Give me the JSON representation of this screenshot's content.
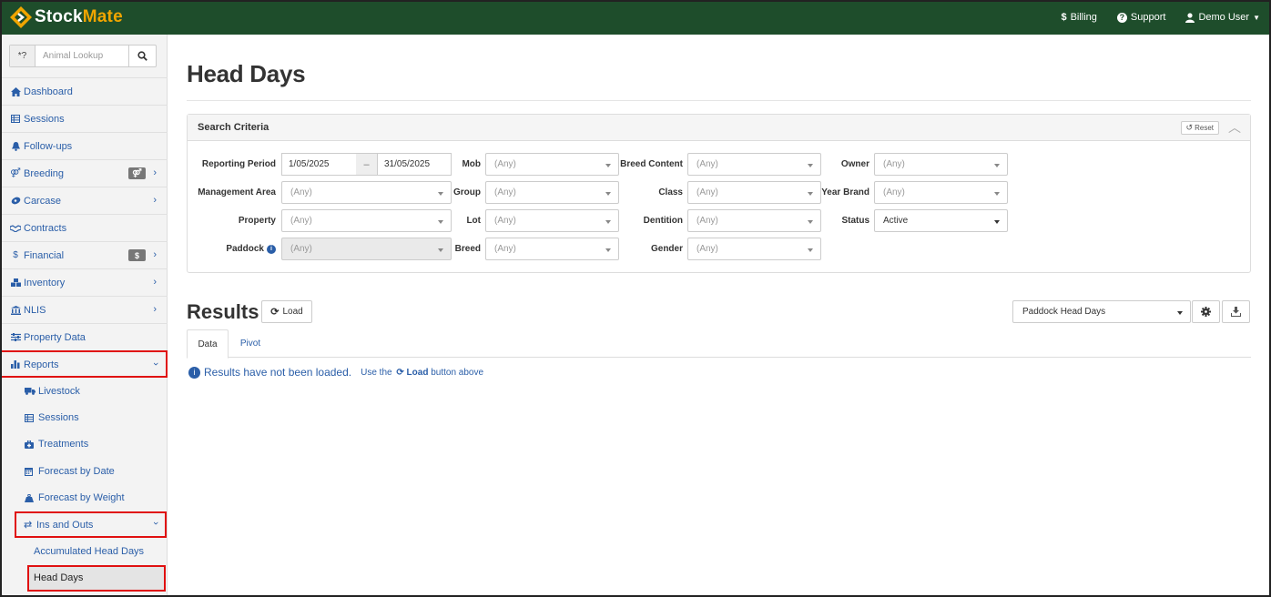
{
  "app": {
    "brand_part1": "Stock",
    "brand_part2": "Mate",
    "accent": "#1e4d2b",
    "link_color": "#2a5ea8"
  },
  "topnav": {
    "billing": "Billing",
    "support": "Support",
    "user": "Demo User"
  },
  "sidebar": {
    "lookup_prefix": "*?",
    "lookup_placeholder": "Animal Lookup",
    "items": [
      {
        "label": "Dashboard",
        "icon": "home-icon"
      },
      {
        "label": "Sessions",
        "icon": "table-icon"
      },
      {
        "label": "Follow-ups",
        "icon": "bell-icon"
      },
      {
        "label": "Breeding",
        "icon": "gender-icon"
      },
      {
        "label": "Carcase",
        "icon": "carcase-icon"
      },
      {
        "label": "Contracts",
        "icon": "handshake-icon"
      },
      {
        "label": "Financial",
        "icon": "dollar-icon",
        "tag": "$"
      },
      {
        "label": "Inventory",
        "icon": "boxes-icon"
      },
      {
        "label": "NLIS",
        "icon": "bank-icon"
      },
      {
        "label": "Property Data",
        "icon": "sliders-icon"
      },
      {
        "label": "Reports",
        "icon": "bar-chart-icon"
      }
    ],
    "reports_sub": [
      {
        "label": "Livestock",
        "icon": "truck-icon"
      },
      {
        "label": "Sessions",
        "icon": "table-icon"
      },
      {
        "label": "Treatments",
        "icon": "medkit-icon"
      },
      {
        "label": "Forecast by Date",
        "icon": "calendar-icon"
      },
      {
        "label": "Forecast by Weight",
        "icon": "weight-icon"
      },
      {
        "label": "Ins and Outs",
        "icon": "exchange-icon"
      }
    ],
    "insouts_sub": [
      {
        "label": "Accumulated Head Days"
      },
      {
        "label": "Head Days"
      }
    ]
  },
  "page": {
    "title": "Head Days"
  },
  "criteria": {
    "title": "Search Criteria",
    "reset": "Reset",
    "reporting_period_label": "Reporting Period",
    "date_from": "1/05/2025",
    "date_sep": "–",
    "date_to": "31/05/2025",
    "management_area_label": "Management Area",
    "property_label": "Property",
    "paddock_label": "Paddock",
    "mob_label": "Mob",
    "group_label": "Group",
    "lot_label": "Lot",
    "breed_label": "Breed",
    "breed_content_label": "Breed Content",
    "class_label": "Class",
    "dentition_label": "Dentition",
    "gender_label": "Gender",
    "owner_label": "Owner",
    "year_brand_label": "Year Brand",
    "status_label": "Status",
    "any": "(Any)",
    "status_value": "Active"
  },
  "results": {
    "title": "Results",
    "load": "Load",
    "report_select": "Paddock Head Days",
    "tab_data": "Data",
    "tab_pivot": "Pivot",
    "notice_main": "Results have not been loaded.",
    "notice_use": "Use the",
    "notice_load": "Load",
    "notice_tail": "button above"
  }
}
